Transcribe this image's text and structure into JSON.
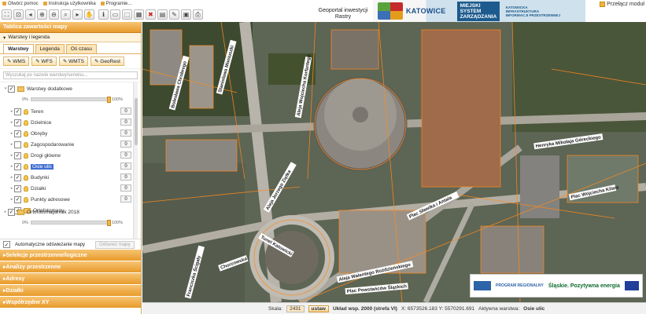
{
  "menu": {
    "items": [
      {
        "label": "Otwórz pomoc"
      },
      {
        "label": "Instrukcja użytkownika"
      },
      {
        "label": "Programie..."
      }
    ]
  },
  "header": {
    "title_line1": "Geoportal inwestycji",
    "title_line2": "Rastry",
    "banner_city": "KATOWICE",
    "banner_system": "MIEJSKI SYSTEM ZARZĄDZANIA",
    "banner_infra": "KATOWICKA INFRASTRUKTURA INFORMACJI PRZESTRZENNEJ",
    "collapse_label": "Przełącz moduł"
  },
  "sidebar": {
    "title": "Tablica zawartości mapy",
    "section": "Warstwy i legenda",
    "tabs": [
      "Warstwy",
      "Legenda",
      "Oś czasu"
    ],
    "services": [
      "WMS",
      "WFS",
      "WMTS",
      "GeoRest"
    ],
    "search_placeholder": "Wyszukaj po nazwie warstwy/serwisu...",
    "group": "Warstwy dodatkowe",
    "opacity_min": "0%",
    "opacity_max": "100%",
    "opacity_value": 1.0,
    "layers": [
      {
        "label": "Teren",
        "count": "0",
        "checked": true
      },
      {
        "label": "Dzielnice",
        "count": "0",
        "checked": true
      },
      {
        "label": "Obręby",
        "count": "0",
        "checked": true
      },
      {
        "label": "Zagospodarowanie",
        "count": "0",
        "checked": false
      },
      {
        "label": "Drogi główne",
        "count": "0",
        "checked": true
      },
      {
        "label": "Osie ulic",
        "count": "0",
        "checked": true
      },
      {
        "label": "Budynki",
        "count": "0",
        "checked": true
      },
      {
        "label": "Działki",
        "count": "0",
        "checked": true
      },
      {
        "label": "Punkty adresowe",
        "count": "0",
        "checked": true
      },
      {
        "label": "Ortofotomapy",
        "count": "",
        "checked": true
      }
    ],
    "group2": "Ortofotomapa rok 2018",
    "auto_label": "Automatyczne odświeżanie mapy",
    "refresh_label": "Odśwież mapę",
    "accordion": [
      "Selekcje przestrzenne/logiczne",
      "Analizy przestrzenne",
      "Adresy",
      "Działki",
      "Współrzędne XY"
    ]
  },
  "map": {
    "streets": [
      "Plac Sławika i Antala",
      "Aleja Wojciecha Korfantego",
      "Henryka Mikołaja Góreckiego",
      "Plac Wojciecha Kilara",
      "Tunel Katowicki",
      "Aleja Walentego Roździeńskiego",
      "Plac Powstańców Śląskich",
      "Chorzowska",
      "Stanisława Moniuszki",
      "Bolesława Chrobrego",
      "Franciszka Ścigały",
      "Aleja Jerzego Ziętka"
    ],
    "eu_label": "Śląskie. Pozytywna energia",
    "eu_program": "PROGRAM REGIONALNY"
  },
  "status": {
    "scale_label": "Skala:",
    "scale_value": "2431",
    "set_label": "ustaw",
    "crs": "Układ wsp. 2000 (strefa VI)",
    "coords": "X: 6573526.183 Y: 5570291.691",
    "active_label": "Aktywna warstwa:",
    "active_value": "Osie ulic"
  },
  "colors": {
    "accent": "#e89a2a",
    "overlay": "#ff8a1c",
    "selected": "#3f6fd1"
  }
}
